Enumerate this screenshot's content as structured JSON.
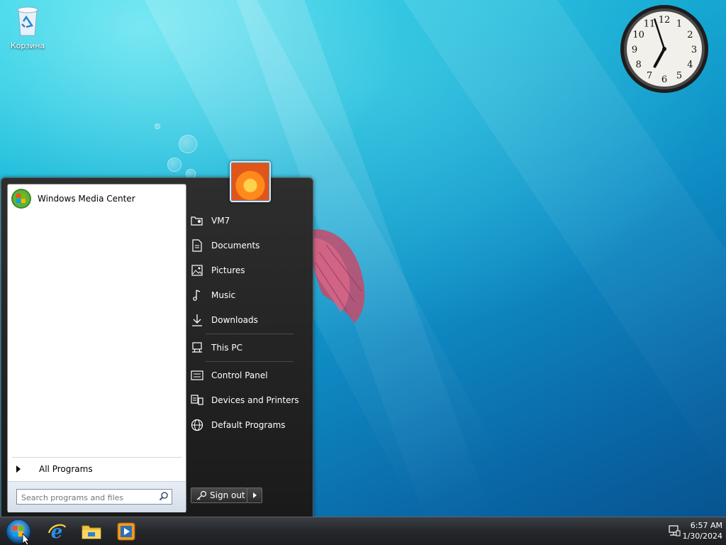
{
  "desktop": {
    "recycle_bin_label": "Корзина"
  },
  "clock_gadget": {
    "time": "6:57",
    "numbers": [
      "12",
      "1",
      "2",
      "3",
      "4",
      "5",
      "6",
      "7",
      "8",
      "9",
      "10",
      "11"
    ]
  },
  "start_menu": {
    "pinned_program": "Windows Media Center",
    "all_programs_label": "All Programs",
    "search_placeholder": "Search programs and files",
    "right_items": [
      {
        "label": "VM7",
        "icon": "user-folder-icon"
      },
      {
        "label": "Documents",
        "icon": "document-icon"
      },
      {
        "label": "Pictures",
        "icon": "picture-icon"
      },
      {
        "label": "Music",
        "icon": "music-note-icon"
      },
      {
        "label": "Downloads",
        "icon": "download-icon"
      },
      {
        "label": "This PC",
        "icon": "computer-icon"
      },
      {
        "label": "Control Panel",
        "icon": "control-panel-icon"
      },
      {
        "label": "Devices and Printers",
        "icon": "devices-printers-icon"
      },
      {
        "label": "Default Programs",
        "icon": "globe-icon"
      }
    ],
    "sign_out_label": "Sign out"
  },
  "taskbar": {
    "pinned": [
      "internet-explorer-icon",
      "file-explorer-icon",
      "media-player-icon"
    ],
    "tray_time": "6:57 AM",
    "tray_date": "1/30/2024"
  },
  "colors": {
    "taskbar": "#26292c",
    "start_menu_right": "#1a1a1a",
    "accent": "#0f8fc6"
  }
}
